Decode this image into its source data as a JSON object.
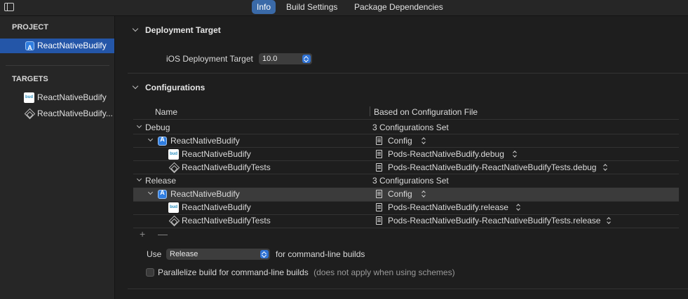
{
  "toolbar": {
    "tabs": [
      {
        "label": "Info",
        "active": true
      },
      {
        "label": "Build Settings",
        "active": false
      },
      {
        "label": "Package Dependencies",
        "active": false
      }
    ]
  },
  "sidebar": {
    "project_header": "PROJECT",
    "project_item": "ReactNativeBudify",
    "targets_header": "TARGETS",
    "targets": [
      {
        "label": "ReactNativeBudify",
        "icon": "bud-app-icon"
      },
      {
        "label": "ReactNativeBudify...",
        "icon": "test-target-icon"
      }
    ]
  },
  "deployment": {
    "title": "Deployment Target",
    "label": "iOS Deployment Target",
    "value": "10.0"
  },
  "configurations": {
    "title": "Configurations",
    "col_name": "Name",
    "col_based": "Based on Configuration File",
    "groups": [
      {
        "name": "Debug",
        "summary": "3 Configurations Set",
        "project": {
          "name": "ReactNativeBudify",
          "config": "Config"
        },
        "targets": [
          {
            "name": "ReactNativeBudify",
            "config": "Pods-ReactNativeBudify.debug"
          },
          {
            "name": "ReactNativeBudifyTests",
            "config": "Pods-ReactNativeBudify-ReactNativeBudifyTests.debug"
          }
        ]
      },
      {
        "name": "Release",
        "summary": "3 Configurations Set",
        "project": {
          "name": "ReactNativeBudify",
          "config": "Config"
        },
        "targets": [
          {
            "name": "ReactNativeBudify",
            "config": "Pods-ReactNativeBudify.release"
          },
          {
            "name": "ReactNativeBudifyTests",
            "config": "Pods-ReactNativeBudify-ReactNativeBudifyTests.release"
          }
        ]
      }
    ],
    "add_symbol": "+",
    "remove_symbol": "—",
    "use_label": "Use",
    "use_value": "Release",
    "use_suffix": "for command-line builds",
    "parallelize_label": "Parallelize build for command-line builds",
    "parallelize_hint": "(does not apply when using schemes)",
    "parallelize_checked": false
  },
  "colors": {
    "accent": "#2f72d4",
    "selection": "#2456a8",
    "background": "#1e1e1e",
    "sidebar": "#262626"
  }
}
